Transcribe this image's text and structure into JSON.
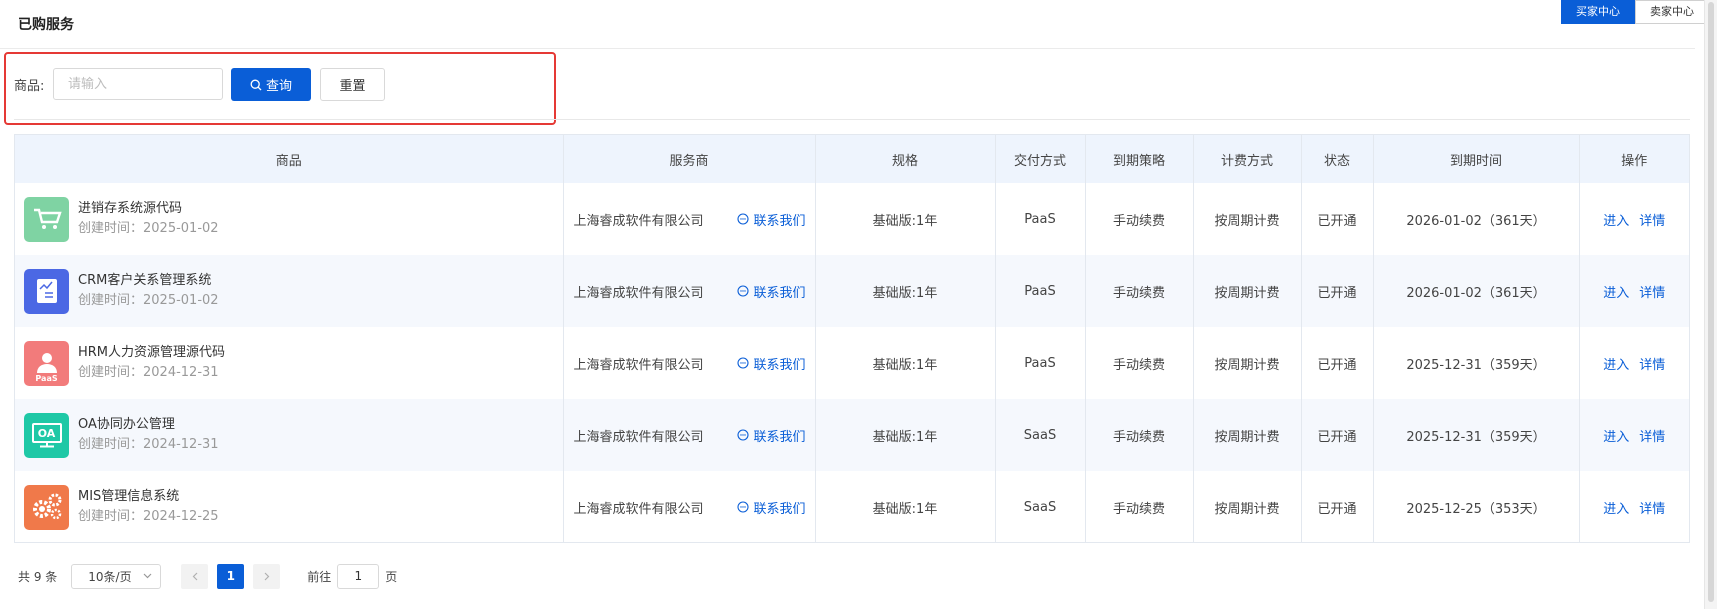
{
  "page": {
    "title": "已购服务"
  },
  "center_switch": {
    "buyer": "买家中心",
    "seller": "卖家中心"
  },
  "search": {
    "label": "商品:",
    "placeholder": "请输入",
    "value": "",
    "query_label": "查询",
    "reset_label": "重置"
  },
  "table": {
    "headers": [
      "商品",
      "服务商",
      "规格",
      "交付方式",
      "到期策略",
      "计费方式",
      "状态",
      "到期时间",
      "操作"
    ],
    "rows": [
      {
        "name": "进销存系统源代码",
        "created": "创建时间：2025-01-02",
        "icon": "cart-icon",
        "icon_color": "#7fd3a3",
        "provider": "上海睿成软件有限公司",
        "contact": "联系我们",
        "spec": "基础版:1年",
        "delivery": "PaaS",
        "policy": "手动续费",
        "billing": "按周期计费",
        "status": "已开通",
        "expire": "2026-01-02（361天）",
        "enter": "进入",
        "detail": "详情"
      },
      {
        "name": "CRM客户关系管理系统",
        "created": "创建时间：2025-01-02",
        "icon": "chart-doc-icon",
        "icon_color": "#4b68e4",
        "provider": "上海睿成软件有限公司",
        "contact": "联系我们",
        "spec": "基础版:1年",
        "delivery": "PaaS",
        "policy": "手动续费",
        "billing": "按周期计费",
        "status": "已开通",
        "expire": "2026-01-02（361天）",
        "enter": "进入",
        "detail": "详情"
      },
      {
        "name": "HRM人力资源管理源代码",
        "created": "创建时间：2024-12-31",
        "icon": "person-icon",
        "icon_color": "#f27b7b",
        "icon_text": "PaaS",
        "provider": "上海睿成软件有限公司",
        "contact": "联系我们",
        "spec": "基础版:1年",
        "delivery": "PaaS",
        "policy": "手动续费",
        "billing": "按周期计费",
        "status": "已开通",
        "expire": "2025-12-31（359天）",
        "enter": "进入",
        "detail": "详情"
      },
      {
        "name": "OA协同办公管理",
        "created": "创建时间：2024-12-31",
        "icon": "monitor-icon",
        "icon_color": "#1ec8a6",
        "icon_text": "OA",
        "provider": "上海睿成软件有限公司",
        "contact": "联系我们",
        "spec": "基础版:1年",
        "delivery": "SaaS",
        "policy": "手动续费",
        "billing": "按周期计费",
        "status": "已开通",
        "expire": "2025-12-31（359天）",
        "enter": "进入",
        "detail": "详情"
      },
      {
        "name": "MIS管理信息系统",
        "created": "创建时间：2024-12-25",
        "icon": "gears-icon",
        "icon_color": "#f0794a",
        "provider": "上海睿成软件有限公司",
        "contact": "联系我们",
        "spec": "基础版:1年",
        "delivery": "SaaS",
        "policy": "手动续费",
        "billing": "按周期计费",
        "status": "已开通",
        "expire": "2025-12-25（353天）",
        "enter": "进入",
        "detail": "详情"
      }
    ]
  },
  "pagination": {
    "total": "共 9 条",
    "page_size": "10条/页",
    "current_page": "1",
    "goto_prefix": "前往",
    "goto_value": "1",
    "goto_suffix": "页"
  }
}
